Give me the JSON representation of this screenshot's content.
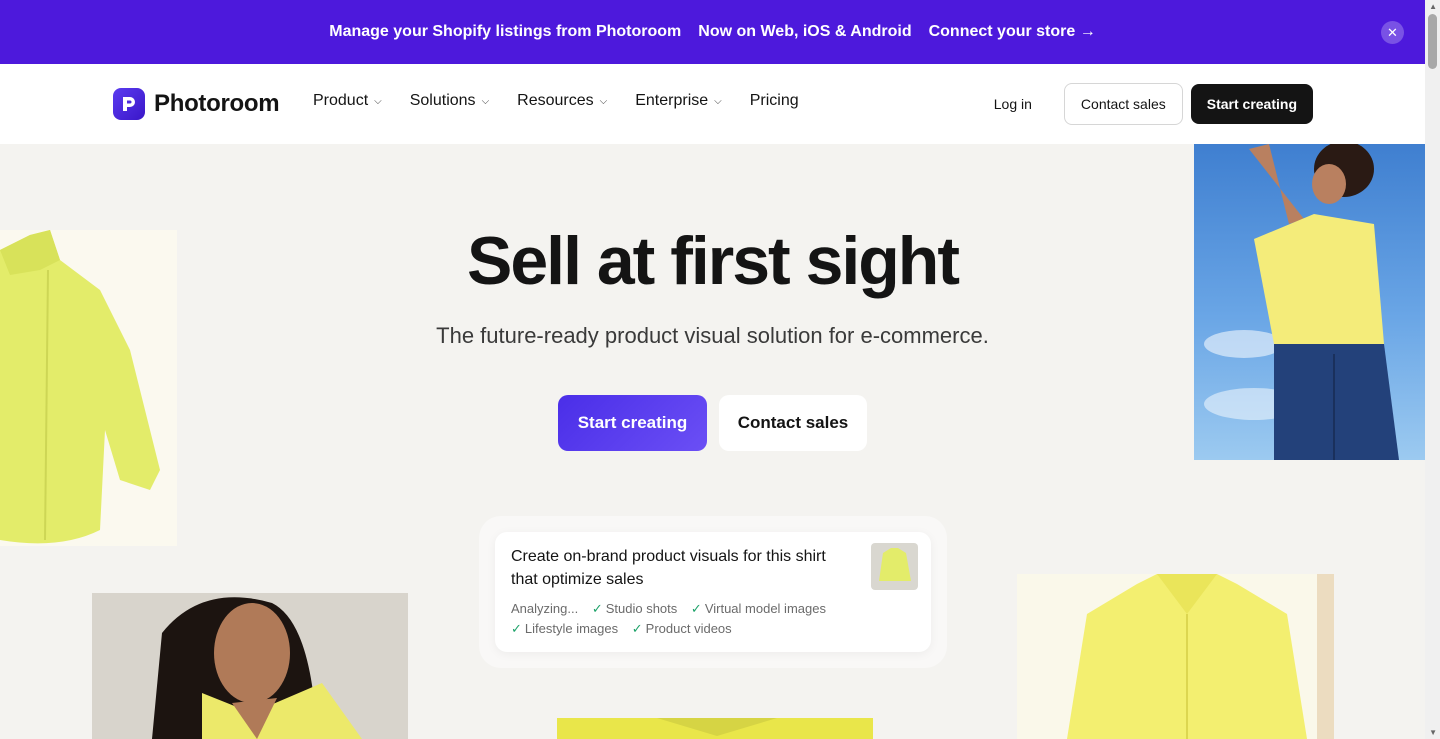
{
  "banner": {
    "text1": "Manage your Shopify listings from Photoroom",
    "text2": "Now on Web, iOS & Android",
    "link": "Connect your store →",
    "close_icon": "close-icon"
  },
  "nav": {
    "logo_text": "Photoroom",
    "items": [
      {
        "label": "Product",
        "dropdown": true
      },
      {
        "label": "Solutions",
        "dropdown": true
      },
      {
        "label": "Resources",
        "dropdown": true
      },
      {
        "label": "Enterprise",
        "dropdown": true
      },
      {
        "label": "Pricing",
        "dropdown": false
      }
    ],
    "login": "Log in",
    "contact": "Contact sales",
    "start": "Start creating"
  },
  "hero": {
    "title": "Sell at first sight",
    "subtitle": "The future-ready product visual solution for e-commerce.",
    "cta_primary": "Start creating",
    "cta_secondary": "Contact sales"
  },
  "prompt": {
    "text": "Create on-brand product visuals for this shirt that optimize sales",
    "status": "Analyzing...",
    "tags": [
      "Studio shots",
      "Virtual model images",
      "Lifestyle images",
      "Product videos"
    ]
  },
  "colors": {
    "brand": "#4d19dc",
    "primary_button": "#4a2ee8",
    "dark_button": "#141414",
    "check": "#1fa36a",
    "shirt_yellow": "#e6ef6a"
  }
}
